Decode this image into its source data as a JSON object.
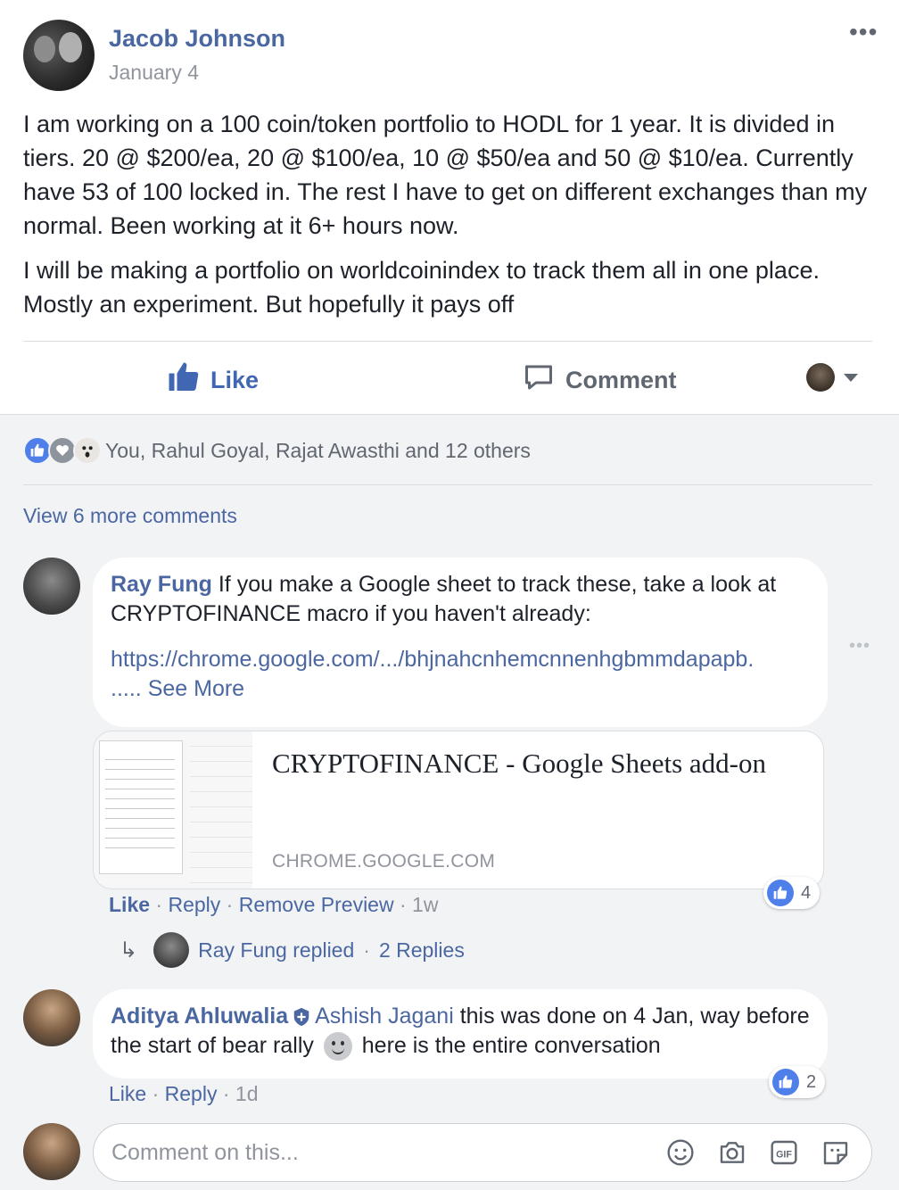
{
  "post": {
    "author": "Jacob Johnson",
    "date": "January 4",
    "paragraph1": "I am working on a 100 coin/token portfolio to HODL for 1 year. It is divided in tiers. 20 @ $200/ea, 20 @ $100/ea, 10 @ $50/ea and 50 @ $10/ea. Currently have 53 of 100 locked in. The rest I have to get on different exchanges than my normal. Been working at it 6+ hours now.",
    "paragraph2": "I will be making a portfolio on worldcoinindex to track them all in one place. Mostly an experiment. But hopefully it pays off",
    "more_icon": "more-dots-icon"
  },
  "actions": {
    "like": "Like",
    "comment": "Comment"
  },
  "reactions": {
    "icons": [
      "like-icon",
      "love-icon",
      "wow-icon"
    ],
    "summary": "You, Rahul Goyal, Rajat Awasthi and 12 others"
  },
  "view_more": "View 6 more comments",
  "comment1": {
    "author": "Ray Fung",
    "text": " If you make a Google sheet to track these, take a look at CRYPTOFINANCE macro if you haven't already:",
    "link": "https://chrome.google.com/.../bhjnahcnhemcnnenhgbmmdapapb.",
    "ellipsis": "..... ",
    "see_more": "See More",
    "preview_title": "CRYPTOFINANCE - Google Sheets add-on",
    "preview_domain": "CHROME.GOOGLE.COM",
    "like": "Like",
    "reply": "Reply",
    "remove_preview": "Remove Preview",
    "time": "1w",
    "like_count": "4",
    "replies_author": "Ray Fung replied",
    "replies_count": "2 Replies"
  },
  "comment2": {
    "author": "Aditya Ahluwalia",
    "mention": "Ashish Jagani",
    "text_before": " this was done on 4 Jan, way before the start of bear rally ",
    "text_after": " here is the entire conversation",
    "like": "Like",
    "reply": "Reply",
    "time": "1d",
    "like_count": "2"
  },
  "composer": {
    "placeholder": "Comment on this...",
    "icons": [
      "emoji-icon",
      "camera-icon",
      "gif-icon",
      "sticker-icon"
    ]
  },
  "colors": {
    "link": "#4b67a1",
    "like_blue": "#4267b2",
    "muted": "#90949c",
    "comments_bg": "#f2f3f5"
  }
}
